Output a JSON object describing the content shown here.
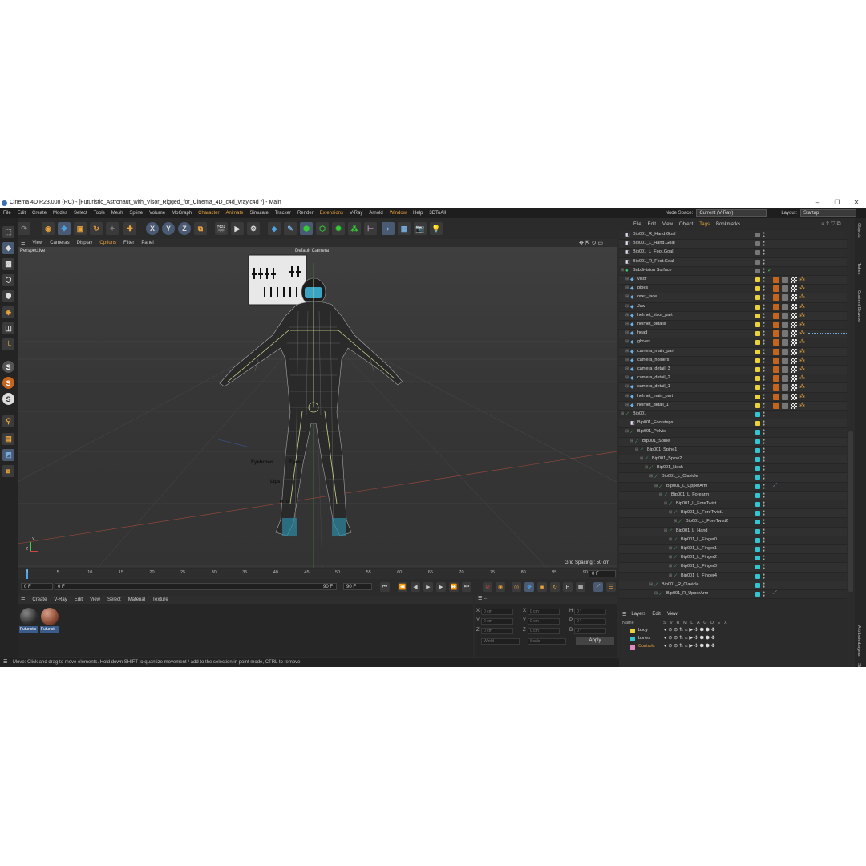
{
  "window": {
    "title": "Cinema 4D R23.008 (RC) - [Futuristic_Astronaut_with_Visor_Rigged_for_Cinema_4D_c4d_vray.c4d *] - Main",
    "min": "–",
    "max": "❐",
    "close": "✕"
  },
  "menubar": {
    "items": [
      "File",
      "Edit",
      "Create",
      "Modes",
      "Select",
      "Tools",
      "Mesh",
      "Spline",
      "Volume",
      "MoGraph",
      "Character",
      "Animate",
      "Simulate",
      "Tracker",
      "Render",
      "Extensions",
      "V-Ray",
      "Arnold",
      "Window",
      "Help",
      "3DToAll"
    ],
    "node_space_label": "Node Space:",
    "node_space_value": "Current (V-Ray)",
    "layout_label": "Layout:",
    "layout_value": "Startup"
  },
  "viewport": {
    "menu": [
      "View",
      "Cameras",
      "Display",
      "Options",
      "Filter",
      "Panel"
    ],
    "projection": "Perspective",
    "camera": "Default Camera",
    "grid_spacing": "Grid Spacing : 50 cm",
    "controls": {
      "eyebrows": "Eyebrows",
      "eyes": "Eyes",
      "lips": "Lips",
      "m": "M",
      "u": "U",
      "i": "I"
    },
    "axis_y": "Y",
    "axis_z": "Z"
  },
  "timeline": {
    "ticks": [
      "0",
      "5",
      "10",
      "15",
      "20",
      "25",
      "30",
      "35",
      "40",
      "45",
      "50",
      "55",
      "60",
      "65",
      "70",
      "75",
      "80",
      "85",
      "90"
    ],
    "current_frame": "0 F"
  },
  "transport": {
    "start": "0 F",
    "current": "0 F",
    "end": "90 F",
    "end2": "90 F"
  },
  "material_manager": {
    "menu": [
      "Create",
      "V-Ray",
      "Edit",
      "View",
      "Select",
      "Material",
      "Texture"
    ],
    "materials": [
      "Futuristic",
      "Futuristi"
    ]
  },
  "coordinates": {
    "header": "--",
    "x": "X",
    "y": "Y",
    "z": "Z",
    "h": "H",
    "p": "P",
    "b": "B",
    "zero_cm": "0 cm",
    "zero_deg": "0 °",
    "mode1": "World",
    "mode2": "Scale",
    "apply": "Apply"
  },
  "status": "Move: Click and drag to move elements. Hold down SHIFT to quantize movement / add to the selection in point mode, CTRL to remove.",
  "object_manager": {
    "menu": [
      "File",
      "Edit",
      "View",
      "Object",
      "Tags",
      "Bookmarks"
    ],
    "rows": [
      {
        "name": "Bip001_R_Hand.Goal",
        "indent": 0,
        "kind": "goal"
      },
      {
        "name": "Bip001_L_Hand.Goal",
        "indent": 0,
        "kind": "goal"
      },
      {
        "name": "Bip001_L_Foot.Goal",
        "indent": 0,
        "kind": "goal"
      },
      {
        "name": "Bip001_R_Foot.Goal",
        "indent": 0,
        "kind": "goal"
      },
      {
        "name": "Subdivision Surface",
        "indent": 0,
        "kind": "subd"
      },
      {
        "name": "visor",
        "indent": 1,
        "kind": "mesh"
      },
      {
        "name": "pipes",
        "indent": 1,
        "kind": "mesh"
      },
      {
        "name": "over_face",
        "indent": 1,
        "kind": "mesh"
      },
      {
        "name": "Jaw",
        "indent": 1,
        "kind": "mesh"
      },
      {
        "name": "helmet_visor_part",
        "indent": 1,
        "kind": "mesh"
      },
      {
        "name": "helmet_details",
        "indent": 1,
        "kind": "mesh"
      },
      {
        "name": "head",
        "indent": 1,
        "kind": "mesh"
      },
      {
        "name": "gloves",
        "indent": 1,
        "kind": "mesh"
      },
      {
        "name": "camera_main_part",
        "indent": 1,
        "kind": "mesh"
      },
      {
        "name": "camera_holders",
        "indent": 1,
        "kind": "mesh"
      },
      {
        "name": "camera_detail_3",
        "indent": 1,
        "kind": "mesh"
      },
      {
        "name": "camera_detail_2",
        "indent": 1,
        "kind": "mesh"
      },
      {
        "name": "camera_detail_1",
        "indent": 1,
        "kind": "mesh"
      },
      {
        "name": "helmet_main_part",
        "indent": 1,
        "kind": "mesh"
      },
      {
        "name": "helmet_detail_1",
        "indent": 1,
        "kind": "mesh"
      },
      {
        "name": "Bip001",
        "indent": 0,
        "kind": "bone"
      },
      {
        "name": "Bip001_Footsteps",
        "indent": 1,
        "kind": "goal"
      },
      {
        "name": "Bip001_Pelvis",
        "indent": 1,
        "kind": "bone"
      },
      {
        "name": "Bip001_Spine",
        "indent": 2,
        "kind": "bone"
      },
      {
        "name": "Bip001_Spine1",
        "indent": 3,
        "kind": "bone"
      },
      {
        "name": "Bip001_Spine2",
        "indent": 4,
        "kind": "bone"
      },
      {
        "name": "Bip001_Neck",
        "indent": 5,
        "kind": "bone"
      },
      {
        "name": "Bip001_L_Clavicle",
        "indent": 6,
        "kind": "bone"
      },
      {
        "name": "Bip001_L_UpperArm",
        "indent": 7,
        "kind": "bone"
      },
      {
        "name": "Bip001_L_Forearm",
        "indent": 8,
        "kind": "bone"
      },
      {
        "name": "Bip001_L_ForeTwist",
        "indent": 9,
        "kind": "bone"
      },
      {
        "name": "Bip001_L_ForeTwist1",
        "indent": 10,
        "kind": "bone"
      },
      {
        "name": "Bip001_L_ForeTwist2",
        "indent": 11,
        "kind": "bone"
      },
      {
        "name": "Bip001_L_Hand",
        "indent": 9,
        "kind": "bone"
      },
      {
        "name": "Bip001_L_Finger0",
        "indent": 10,
        "kind": "bone"
      },
      {
        "name": "Bip001_L_Finger1",
        "indent": 10,
        "kind": "bone"
      },
      {
        "name": "Bip001_L_Finger2",
        "indent": 10,
        "kind": "bone"
      },
      {
        "name": "Bip001_L_Finger3",
        "indent": 10,
        "kind": "bone"
      },
      {
        "name": "Bip001_L_Finger4",
        "indent": 10,
        "kind": "bone"
      },
      {
        "name": "Bip001_R_Clavicle",
        "indent": 6,
        "kind": "bone"
      },
      {
        "name": "Bip001_R_UpperArm",
        "indent": 7,
        "kind": "bone"
      }
    ]
  },
  "layers": {
    "menu": [
      "Layers",
      "Edit",
      "View"
    ],
    "header_name": "Name",
    "header_cols": [
      "S",
      "V",
      "R",
      "M",
      "L",
      "A",
      "G",
      "D",
      "E",
      "X"
    ],
    "rows": [
      {
        "name": "body",
        "color": "#e8d43a"
      },
      {
        "name": "bones",
        "color": "#34c6cf"
      },
      {
        "name": "Controls",
        "color": "#e08cc0"
      }
    ]
  },
  "side_tabs": [
    "Objects",
    "Takes",
    "Content Browser",
    "Attributes",
    "Layers",
    "Structure"
  ],
  "colors": {
    "accent": "#e8a33c",
    "mesh_tag": "#e8d43a",
    "bone_tag": "#34c6cf",
    "selection": "#3b5b8a"
  }
}
